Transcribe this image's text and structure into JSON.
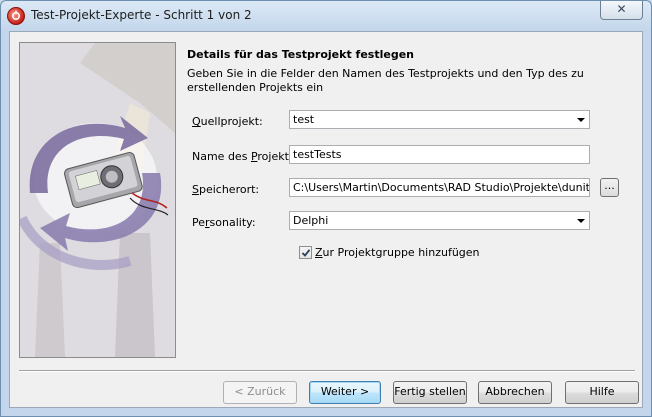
{
  "window": {
    "title": "Test-Projekt-Experte - Schritt 1 von 2",
    "close_label": "✕"
  },
  "content": {
    "heading": "Details für das Testprojekt festlegen",
    "description": "Geben Sie in die Felder den Namen des Testprojekts und den Typ des zu erstellenden Projekts ein"
  },
  "form": {
    "source_project": {
      "label_pre": "",
      "label_key": "Q",
      "label_post": "uellprojekt:",
      "value": "test"
    },
    "project_name": {
      "label_pre": "Name des ",
      "label_key": "P",
      "label_post": "rojekts:",
      "value": "testTests"
    },
    "location": {
      "label_pre": "",
      "label_key": "S",
      "label_post": "peicherort:",
      "value": "C:\\Users\\Martin\\Documents\\RAD Studio\\Projekte\\dunit\\Test",
      "browse_label": "..."
    },
    "personality": {
      "label_pre": "Pe",
      "label_key": "r",
      "label_post": "sonality:",
      "value": "Delphi"
    },
    "add_to_group": {
      "label_pre": "",
      "label_key": "Z",
      "label_post": "ur Projektgruppe hinzufügen",
      "checked": true
    }
  },
  "buttons": {
    "back": "< Zurück",
    "next": "Weiter >",
    "finish": "Fertig stellen",
    "cancel": "Abbrechen",
    "help": "Hilfe"
  },
  "colors": {
    "title_bar": "#c3d6eb",
    "dialog_bg": "#f0f0f0",
    "default_button_border": "#3c7fb1"
  }
}
